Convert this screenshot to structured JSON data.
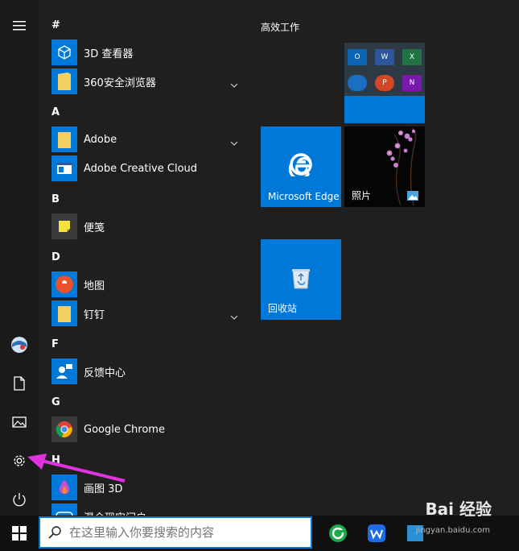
{
  "groups": [
    "#",
    "A",
    "B",
    "D",
    "F",
    "G",
    "H"
  ],
  "apps": [
    {
      "label": "3D 查看器"
    },
    {
      "label": "360安全浏览器"
    },
    {
      "label": "Adobe"
    },
    {
      "label": "Adobe Creative Cloud"
    },
    {
      "label": "便笺"
    },
    {
      "label": "地图"
    },
    {
      "label": "钉钉"
    },
    {
      "label": "反馈中心"
    },
    {
      "label": "Google Chrome"
    },
    {
      "label": "画图 3D"
    },
    {
      "label": "混合现实门户"
    }
  ],
  "tiles": {
    "group_title": "高效工作",
    "edge": "Microsoft Edge",
    "photos": "照片",
    "recycle": "回收站"
  },
  "taskbar": {
    "search_placeholder": "在这里输入你要搜索的内容"
  },
  "watermark": {
    "main": "Bai 经验",
    "sub": "jingyan.baidu.com"
  },
  "colors": {
    "accent": "#0078d7",
    "annotation_arrow": "#e033e0"
  }
}
